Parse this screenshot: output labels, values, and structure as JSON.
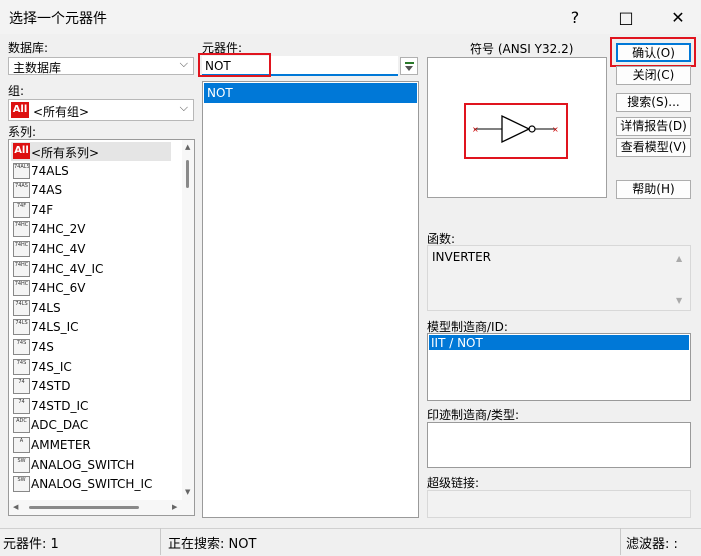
{
  "window": {
    "title": "选择一个元器件",
    "help_icon": "?",
    "minimize_icon": "—",
    "maximize_icon": "□",
    "close_icon": "✕"
  },
  "left": {
    "db_label": "数据库:",
    "db_value": "主数据库",
    "group_label": "组:",
    "group_value": "<所有组>",
    "all_badge": "All",
    "series_label": "系列:",
    "series": [
      {
        "name": "<所有系列>",
        "icon": "All"
      },
      {
        "name": "74ALS",
        "icon": "74ALS"
      },
      {
        "name": "74AS",
        "icon": "74AS"
      },
      {
        "name": "74F",
        "icon": "74F"
      },
      {
        "name": "74HC_2V",
        "icon": "74HC"
      },
      {
        "name": "74HC_4V",
        "icon": "74HC"
      },
      {
        "name": "74HC_4V_IC",
        "icon": "74HC"
      },
      {
        "name": "74HC_6V",
        "icon": "74HC"
      },
      {
        "name": "74LS",
        "icon": "74LS"
      },
      {
        "name": "74LS_IC",
        "icon": "74LS"
      },
      {
        "name": "74S",
        "icon": "74S"
      },
      {
        "name": "74S_IC",
        "icon": "74S"
      },
      {
        "name": "74STD",
        "icon": "74"
      },
      {
        "name": "74STD_IC",
        "icon": "74"
      },
      {
        "name": "ADC_DAC",
        "icon": "ADC"
      },
      {
        "name": "AMMETER",
        "icon": "A"
      },
      {
        "name": "ANALOG_SWITCH",
        "icon": "SW"
      },
      {
        "name": "ANALOG_SWITCH_IC",
        "icon": "SW"
      }
    ]
  },
  "middle": {
    "component_label": "元器件:",
    "search_value": "NOT",
    "filter_icon": "filter-icon",
    "components": [
      "NOT"
    ]
  },
  "right": {
    "symbol_label": "符号 (ANSI Y32.2)",
    "function_label": "函数:",
    "function_value": "INVERTER",
    "model_label": "模型制造商/ID:",
    "model_items": [
      "IIT / NOT"
    ],
    "footprint_label": "印迹制造商/类型:",
    "hyperlink_label": "超级链接:"
  },
  "buttons": {
    "ok": "确认(O)",
    "close": "关闭(C)",
    "search": "搜索(S)...",
    "detail": "详情报告(D)",
    "model": "查看模型(V)",
    "help": "帮助(H)"
  },
  "status": {
    "count": "元器件: 1",
    "searching": "正在搜索: NOT",
    "filter": "滤波器: :"
  },
  "colors": {
    "selection": "#0078d7",
    "highlight_box": "#e0141e",
    "window_bg": "#f0f0f0"
  }
}
